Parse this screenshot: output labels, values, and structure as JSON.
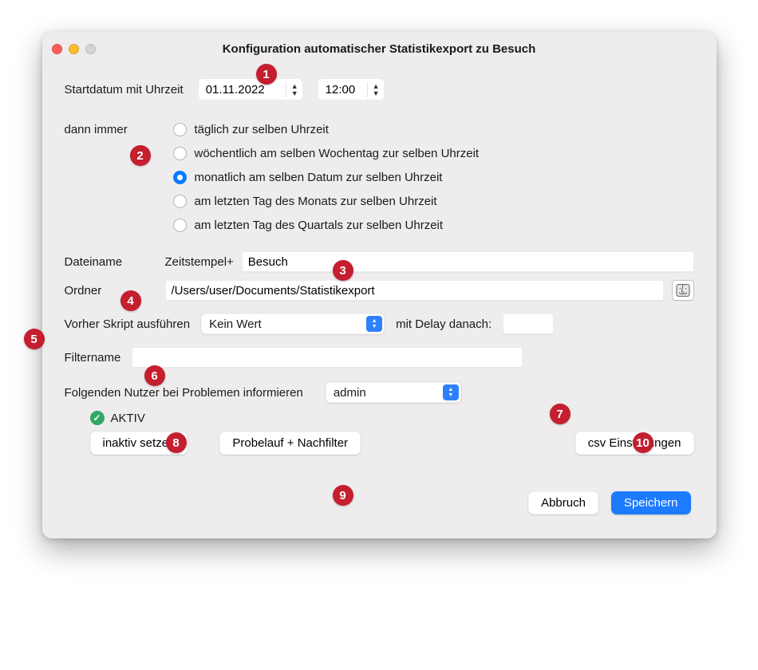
{
  "title": "Konfiguration automatischer Statistikexport zu Besuch",
  "start": {
    "label": "Startdatum mit Uhrzeit",
    "date": "01.11.2022",
    "time": "12:00"
  },
  "repeat": {
    "label": "dann immer",
    "options": [
      "täglich zur selben Uhrzeit",
      "wöchentlich am selben Wochentag zur selben Uhrzeit",
      "monatlich am selben Datum zur selben Uhrzeit",
      "am letzten Tag des Monats zur selben Uhrzeit",
      "am letzten Tag des Quartals zur selben Uhrzeit"
    ],
    "selected_index": 2
  },
  "filename": {
    "label": "Dateiname",
    "prefix": "Zeitstempel+",
    "value": "Besuch"
  },
  "folder": {
    "label": "Ordner",
    "value": "/Users/user/Documents/Statistikexport"
  },
  "script": {
    "before_label": "Vorher Skript ausführen",
    "value": "Kein Wert",
    "delay_label": "mit Delay danach:",
    "delay_value": ""
  },
  "filter": {
    "label": "Filtername",
    "value": ""
  },
  "notify": {
    "label": "Folgenden Nutzer bei Problemen informieren",
    "value": "admin"
  },
  "status": {
    "text": "AKTIV"
  },
  "buttons": {
    "deactivate": "inaktiv setzen",
    "test_run": "Probelauf + Nachfilter",
    "csv_settings": "csv Einstellungen",
    "cancel": "Abbruch",
    "save": "Speichern"
  },
  "annotations": [
    "1",
    "2",
    "3",
    "4",
    "5",
    "6",
    "7",
    "8",
    "9",
    "10"
  ],
  "colors": {
    "accent": "#1d7bff",
    "badge": "#c41e2f",
    "active": "#2fa866"
  }
}
